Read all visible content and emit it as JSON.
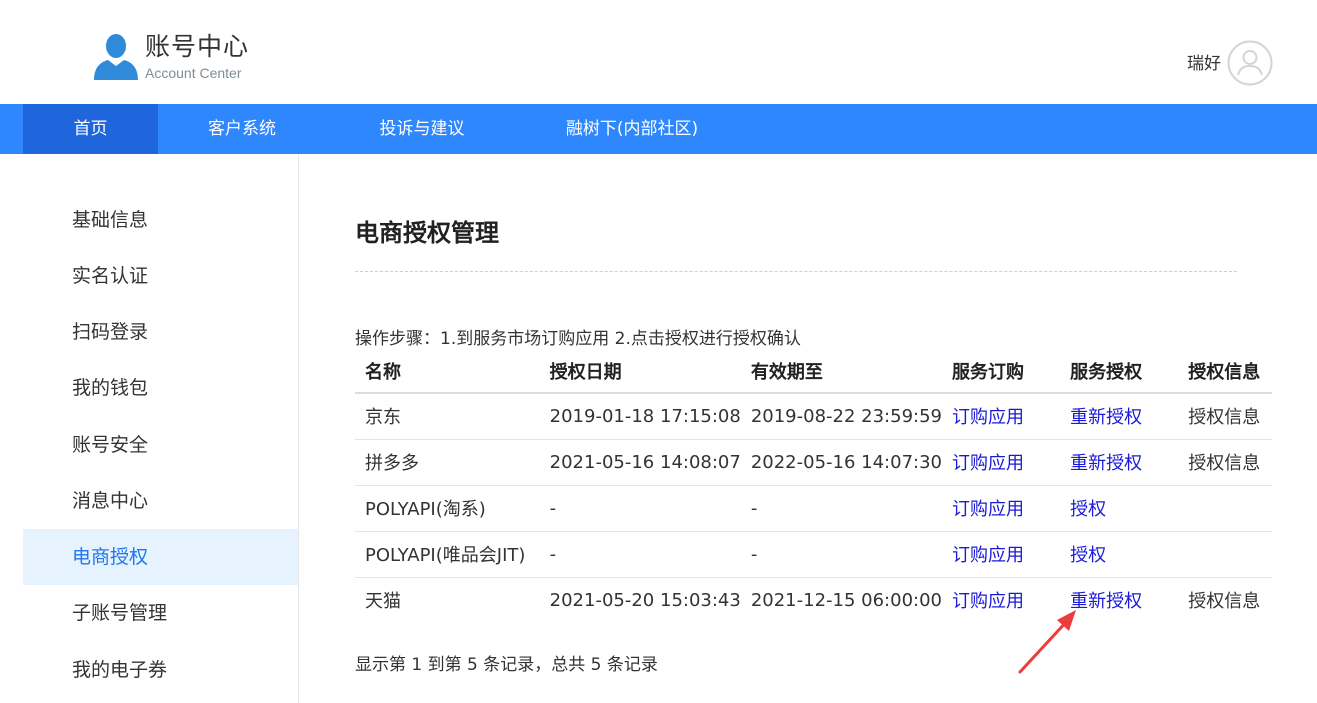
{
  "header": {
    "title": "账号中心",
    "subtitle": "Account Center",
    "username": "瑞好"
  },
  "nav": {
    "items": [
      {
        "label": "首页"
      },
      {
        "label": "客户系统"
      },
      {
        "label": "投诉与建议"
      },
      {
        "label": "融树下(内部社区)"
      }
    ]
  },
  "sidebar": {
    "items": [
      {
        "label": "基础信息"
      },
      {
        "label": "实名认证"
      },
      {
        "label": "扫码登录"
      },
      {
        "label": "我的钱包"
      },
      {
        "label": "账号安全"
      },
      {
        "label": "消息中心"
      },
      {
        "label": "电商授权"
      },
      {
        "label": "子账号管理"
      },
      {
        "label": "我的电子券"
      }
    ],
    "active_index": 6
  },
  "main": {
    "title": "电商授权管理",
    "steps": "操作步骤：1.到服务市场订购应用 2.点击授权进行授权确认",
    "table": {
      "headers": [
        "名称",
        "授权日期",
        "有效期至",
        "服务订购",
        "服务授权",
        "授权信息"
      ],
      "rows": [
        {
          "name": "京东",
          "auth_date": "2019-01-18 17:15:08",
          "expire": "2019-08-22 23:59:59",
          "order": "订购应用",
          "auth": "重新授权",
          "info": "授权信息"
        },
        {
          "name": "拼多多",
          "auth_date": "2021-05-16 14:08:07",
          "expire": "2022-05-16 14:07:30",
          "order": "订购应用",
          "auth": "重新授权",
          "info": "授权信息"
        },
        {
          "name": "POLYAPI(淘系)",
          "auth_date": "-",
          "expire": "-",
          "order": "订购应用",
          "auth": "授权",
          "info": ""
        },
        {
          "name": "POLYAPI(唯品会JIT)",
          "auth_date": "-",
          "expire": "-",
          "order": "订购应用",
          "auth": "授权",
          "info": ""
        },
        {
          "name": "天猫",
          "auth_date": "2021-05-20 15:03:43",
          "expire": "2021-12-15 06:00:00",
          "order": "订购应用",
          "auth": "重新授权",
          "info": "授权信息"
        }
      ]
    },
    "record_count": "显示第 1 到第 5 条记录，总共 5 条记录"
  },
  "colors": {
    "nav_bg": "#2f87fe",
    "nav_active": "#1f66dc",
    "link": "#1a1ad6",
    "sidebar_active_bg": "#e6f2fd",
    "sidebar_active_text": "#1f78f0",
    "annotation_arrow": "#ee3b3b"
  },
  "icons": {
    "logo": "user-silhouette-icon",
    "avatar": "user-circle-icon",
    "annotation": "red-arrow-annotation"
  }
}
